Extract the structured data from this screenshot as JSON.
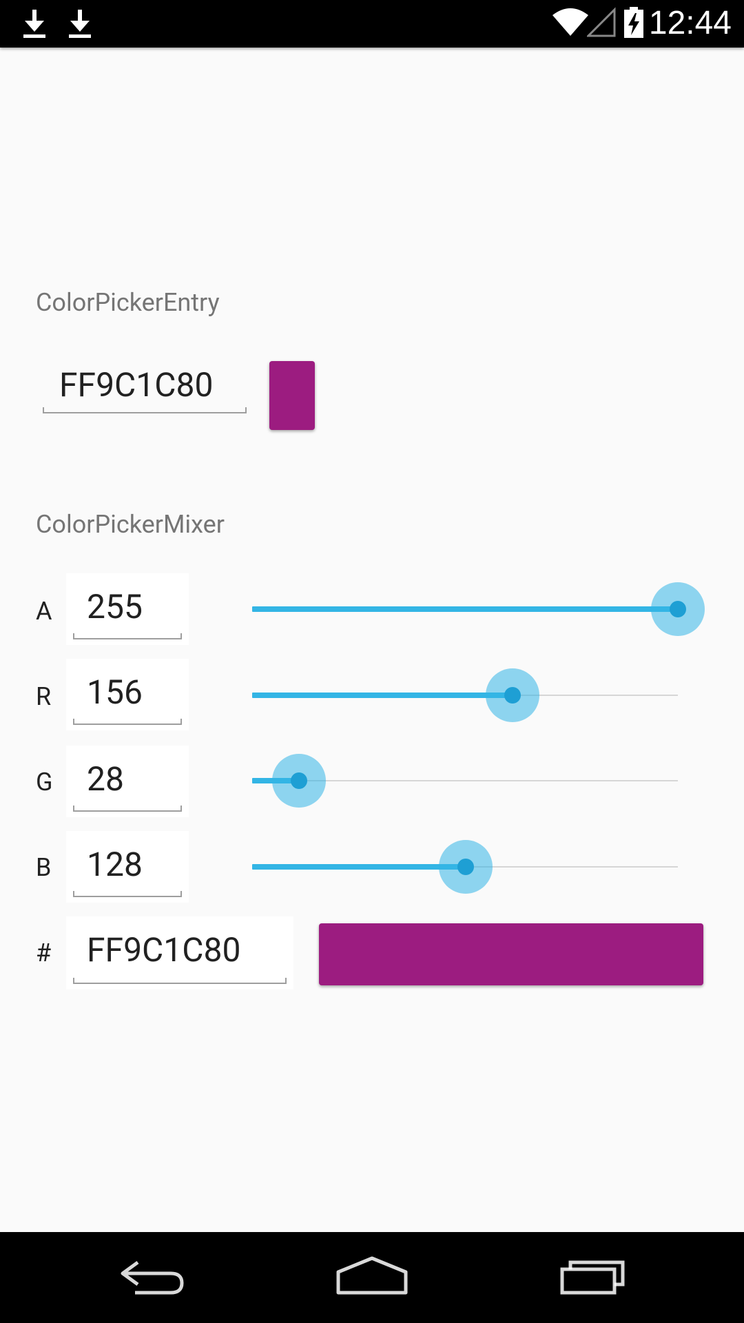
{
  "status_bar": {
    "time": "12:44",
    "left_icons": [
      "download-icon",
      "download-icon"
    ],
    "right_icons": [
      "wifi-icon",
      "cell-signal-icon",
      "battery-charging-icon"
    ]
  },
  "entry": {
    "section_label": "ColorPickerEntry",
    "hex_value": "FF9C1C80",
    "swatch_color": "#9C1C80"
  },
  "mixer": {
    "section_label": "ColorPickerMixer",
    "channels": [
      {
        "label": "A",
        "value": "255",
        "fraction": 1.0
      },
      {
        "label": "R",
        "value": "156",
        "fraction": 0.612
      },
      {
        "label": "G",
        "value": "28",
        "fraction": 0.11
      },
      {
        "label": "B",
        "value": "128",
        "fraction": 0.502
      }
    ],
    "hex_label": "#",
    "hex_value": "FF9C1C80",
    "preview_color": "#9C1C80",
    "accent_color": "#33B5E5"
  },
  "nav_bar": {
    "buttons": [
      "back-icon",
      "home-icon",
      "recents-icon"
    ]
  }
}
